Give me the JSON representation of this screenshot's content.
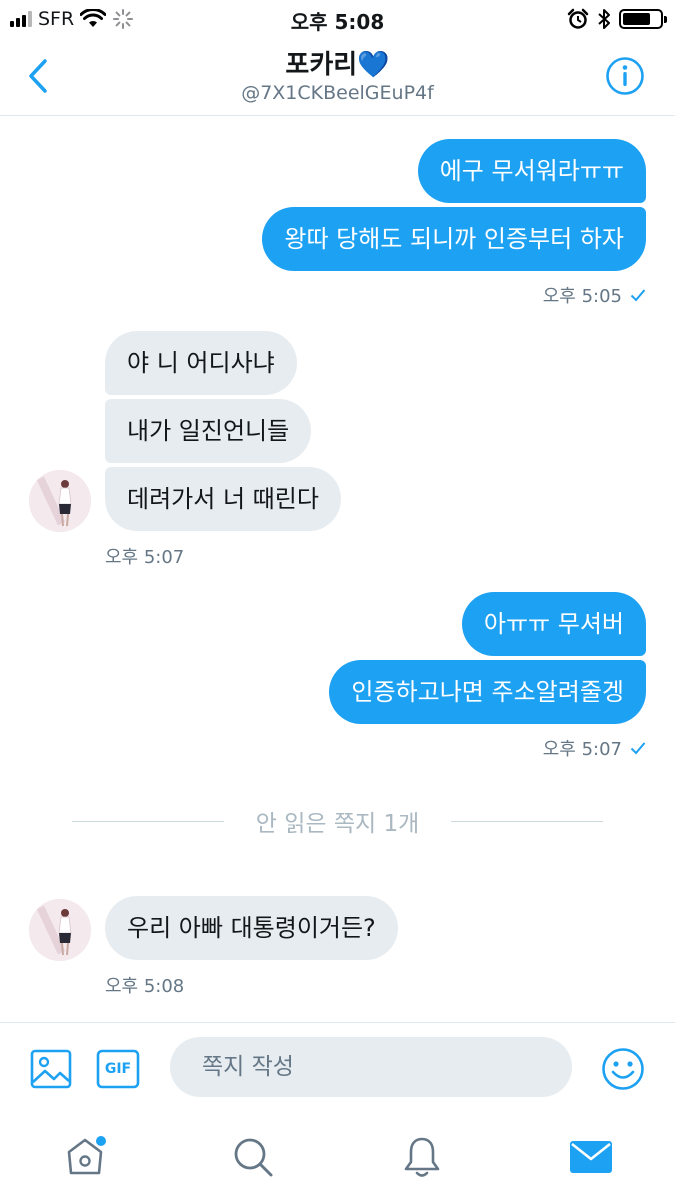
{
  "status_bar": {
    "carrier": "SFR",
    "time": "오후 5:08"
  },
  "header": {
    "name": "포카리💙",
    "handle": "@7X1CKBeelGEuP4f"
  },
  "messages": [
    {
      "direction": "sent",
      "text": "에구 무서워라ㅠㅠ"
    },
    {
      "direction": "sent",
      "text": "왕따 당해도 되니까 인증부터 하자"
    },
    {
      "direction": "received",
      "text": "야 니 어디사냐"
    },
    {
      "direction": "received",
      "text": "내가 일진언니들"
    },
    {
      "direction": "received",
      "text": "데려가서 너 때린다"
    },
    {
      "direction": "sent",
      "text": "아ㅠㅠ 무셔버"
    },
    {
      "direction": "sent",
      "text": "인증하고나면 주소알려줄겡"
    },
    {
      "direction": "received",
      "text": "우리 아빠 대통령이거든?"
    }
  ],
  "timestamps": {
    "group1": "오후 5:05",
    "group2": "오후 5:07",
    "group3": "오후 5:07",
    "group4": "오후 5:08"
  },
  "unread_divider": "안 읽은 쪽지 1개",
  "composer": {
    "placeholder": "쪽지 작성",
    "value": "",
    "gif_label": "GIF"
  },
  "tabs": [
    {
      "name": "home",
      "icon": "home-icon",
      "has_badge": true
    },
    {
      "name": "search",
      "icon": "search-icon"
    },
    {
      "name": "notifications",
      "icon": "bell-icon"
    },
    {
      "name": "messages",
      "icon": "mail-icon",
      "active": true
    }
  ],
  "colors": {
    "accent": "#1da1f2",
    "received_bubble": "#e6ecf0",
    "meta_text": "#657786"
  }
}
